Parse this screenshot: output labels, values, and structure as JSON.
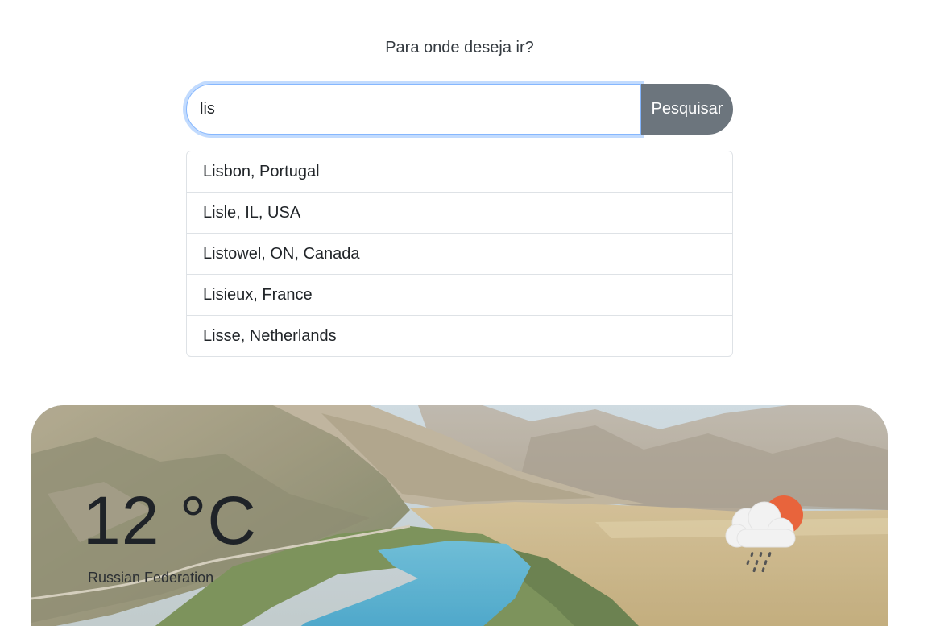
{
  "search": {
    "prompt": "Para onde deseja ir?",
    "value": "lis",
    "button_label": "Pesquisar"
  },
  "suggestions": [
    "Lisbon, Portugal",
    "Lisle, IL, USA",
    "Listowel, ON, Canada",
    "Lisieux, France",
    "Lisse, Netherlands"
  ],
  "weather": {
    "temperature": "12 °C",
    "location": "Russian Federation",
    "icon": "cloud-sun-rain-icon"
  },
  "colors": {
    "button": "#6c757d",
    "focus": "#86b7fe",
    "sun": "#e8643c",
    "river": "#3ea3c7"
  }
}
